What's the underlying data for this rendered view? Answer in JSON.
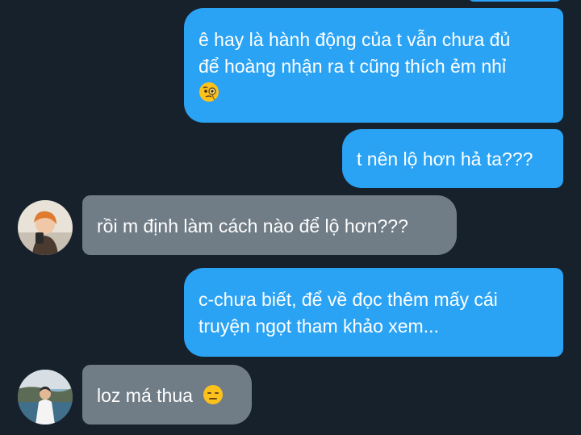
{
  "messages": [
    {
      "direction": "outgoing",
      "lines": [
        "ê hay là hành động của t vẫn chưa đủ",
        "để hoàng nhận ra t cũng thích ẻm nhỉ"
      ],
      "emoji": "face-with-monocle-emoji"
    },
    {
      "direction": "outgoing",
      "lines": [
        "t nên lộ hơn hả ta???"
      ]
    },
    {
      "direction": "incoming",
      "lines": [
        "rồi m định làm cách nào để lộ hơn???"
      ],
      "avatar": "avatar-person-orange-hair"
    },
    {
      "direction": "outgoing",
      "lines": [
        "c-chưa biết, để về đọc thêm mấy cái",
        "truyện ngọt tham khảo xem..."
      ]
    },
    {
      "direction": "incoming",
      "lines": [
        "loz má thua"
      ],
      "emoji": "expressionless-face-emoji",
      "avatar": "avatar-person-white-shirt"
    }
  ],
  "colors": {
    "background": "#17212b",
    "outgoing_bubble": "#2aa3f5",
    "incoming_bubble": "#707c86",
    "text": "#ffffff"
  }
}
